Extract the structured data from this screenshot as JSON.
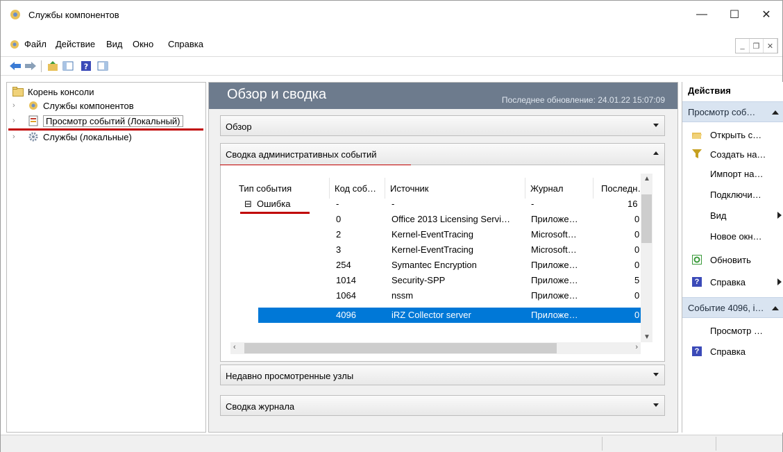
{
  "window": {
    "title": "Службы компонентов",
    "min": "—",
    "max": "☐",
    "close": "✕"
  },
  "menu": [
    "Файл",
    "Действие",
    "Вид",
    "Окно",
    "Справка"
  ],
  "tree": {
    "root": "Корень консоли",
    "items": [
      "Службы компонентов",
      "Просмотр событий (Локальный)",
      "Службы (локальные)"
    ]
  },
  "center": {
    "title": "Обзор и сводка",
    "last_update": "Последнее обновление: 24.01.22 15:07:09",
    "panels": {
      "overview": "Обзор",
      "admin_summary": "Сводка административных событий",
      "recent_nodes": "Недавно просмотренные узлы",
      "log_summary": "Сводка журнала"
    }
  },
  "grid": {
    "columns": [
      "Тип события",
      "Код соб…",
      "Источник",
      "Журнал",
      "Последн…"
    ],
    "group": {
      "expander": "⊟",
      "label": "Ошибка",
      "code": "-",
      "source": "-",
      "log": "-",
      "last": "16"
    },
    "rows": [
      {
        "code": "0",
        "source": "Office 2013 Licensing Servi…",
        "log": "Приложе…",
        "last": "0"
      },
      {
        "code": "2",
        "source": "Kernel-EventTracing",
        "log": "Microsoft…",
        "last": "0"
      },
      {
        "code": "3",
        "source": "Kernel-EventTracing",
        "log": "Microsoft…",
        "last": "0"
      },
      {
        "code": "254",
        "source": "Symantec Encryption",
        "log": "Приложе…",
        "last": "0"
      },
      {
        "code": "1014",
        "source": "Security-SPP",
        "log": "Приложе…",
        "last": "5"
      },
      {
        "code": "1064",
        "source": "nssm",
        "log": "Приложе…",
        "last": "0"
      },
      {
        "code": "4096",
        "source": "iRZ Collector server",
        "log": "Приложе…",
        "last": "0"
      }
    ]
  },
  "actions": {
    "title": "Действия",
    "section1": "Просмотр соб…",
    "items1": [
      "Открыть с…",
      "Создать на…",
      "Импорт на…",
      "Подключи…",
      "Вид",
      "Новое окн…",
      "Обновить",
      "Справка"
    ],
    "section2": "Событие 4096, i…",
    "items2": [
      "Просмотр …",
      "Справка"
    ]
  },
  "colors": {
    "accent": "#0078d7",
    "header": "#6d7b8d",
    "underline": "#c00000",
    "action_section": "#d9e4f1"
  }
}
